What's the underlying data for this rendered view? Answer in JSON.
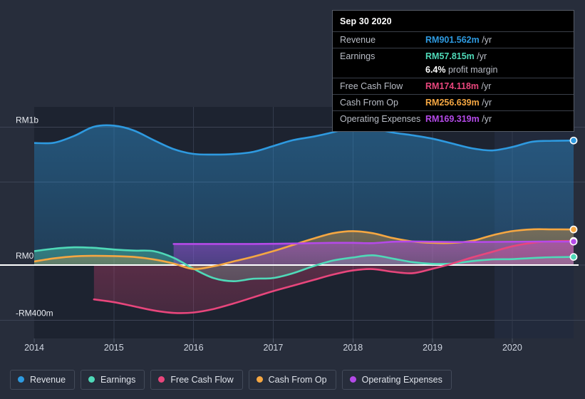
{
  "tooltip": {
    "date": "Sep 30 2020",
    "rows": [
      {
        "label": "Revenue",
        "value": "RM901.562m",
        "unit": "/yr",
        "color": "#2e9ae0"
      },
      {
        "label": "Earnings",
        "value": "RM57.815m",
        "unit": "/yr",
        "color": "#4fd9b8",
        "sub_value": "6.4%",
        "sub_unit": "profit margin"
      },
      {
        "label": "Free Cash Flow",
        "value": "RM174.118m",
        "unit": "/yr",
        "color": "#e8467c"
      },
      {
        "label": "Cash From Op",
        "value": "RM256.639m",
        "unit": "/yr",
        "color": "#f5a742"
      },
      {
        "label": "Operating Expenses",
        "value": "RM169.319m",
        "unit": "/yr",
        "color": "#b44ae8"
      }
    ]
  },
  "legend": {
    "items": [
      {
        "label": "Revenue",
        "color": "#2e9ae0"
      },
      {
        "label": "Earnings",
        "color": "#4fd9b8"
      },
      {
        "label": "Free Cash Flow",
        "color": "#e8467c"
      },
      {
        "label": "Cash From Op",
        "color": "#f5a742"
      },
      {
        "label": "Operating Expenses",
        "color": "#b44ae8"
      }
    ]
  },
  "chart_data": {
    "type": "area",
    "title": "",
    "xlabel": "",
    "ylabel": "",
    "currency": "RM",
    "grid": true,
    "legend_position": "bottom",
    "y_ticks": [
      {
        "label": "RM1b",
        "value": 1000
      },
      {
        "label": "RM0",
        "value": 0
      },
      {
        "label": "-RM400m",
        "value": -400
      }
    ],
    "ylim": [
      -533,
      1146
    ],
    "x_ticks": [
      "2014",
      "2015",
      "2016",
      "2017",
      "2018",
      "2019",
      "2020"
    ],
    "xlim": [
      2014,
      2020.77
    ],
    "forecast_start": 2019.77,
    "series": [
      {
        "name": "Revenue",
        "color": "#2e9ae0",
        "fill": "#2e9ae0",
        "x": [
          2014.0,
          2014.25,
          2014.5,
          2014.75,
          2015.0,
          2015.25,
          2015.5,
          2015.75,
          2016.0,
          2016.25,
          2016.5,
          2016.75,
          2017.0,
          2017.25,
          2017.5,
          2017.75,
          2018.0,
          2018.25,
          2018.5,
          2018.75,
          2019.0,
          2019.25,
          2019.5,
          2019.75,
          2020.0,
          2020.25,
          2020.5,
          2020.77
        ],
        "values": [
          884,
          886,
          935,
          1002,
          1010,
          975,
          905,
          840,
          805,
          800,
          804,
          820,
          862,
          905,
          930,
          962,
          1000,
          990,
          960,
          940,
          915,
          880,
          845,
          830,
          855,
          893,
          900,
          902
        ]
      },
      {
        "name": "Earnings",
        "color": "#4fd9b8",
        "fill": "#4fd9b8",
        "x": [
          2014.0,
          2014.25,
          2014.5,
          2014.75,
          2015.0,
          2015.25,
          2015.5,
          2015.75,
          2016.0,
          2016.25,
          2016.5,
          2016.75,
          2017.0,
          2017.25,
          2017.5,
          2017.75,
          2018.0,
          2018.25,
          2018.5,
          2018.75,
          2019.0,
          2019.25,
          2019.5,
          2019.75,
          2020.0,
          2020.25,
          2020.5,
          2020.77
        ],
        "values": [
          100,
          118,
          128,
          124,
          112,
          104,
          100,
          52,
          -28,
          -95,
          -118,
          -100,
          -95,
          -60,
          -10,
          32,
          54,
          70,
          46,
          20,
          8,
          10,
          28,
          40,
          42,
          50,
          56,
          58
        ]
      },
      {
        "name": "Free Cash Flow",
        "color": "#e8467c",
        "fill": "#e8467c",
        "x": [
          2014.75,
          2015.0,
          2015.25,
          2015.5,
          2015.75,
          2016.0,
          2016.25,
          2016.5,
          2016.75,
          2017.0,
          2017.25,
          2017.5,
          2017.75,
          2018.0,
          2018.25,
          2018.5,
          2018.75,
          2019.0,
          2019.25,
          2019.5,
          2019.75,
          2020.0,
          2020.25,
          2020.5,
          2020.77
        ],
        "values": [
          -250,
          -270,
          -300,
          -330,
          -348,
          -345,
          -320,
          -280,
          -235,
          -190,
          -150,
          -110,
          -70,
          -40,
          -30,
          -50,
          -60,
          -28,
          10,
          55,
          95,
          135,
          160,
          172,
          174
        ]
      },
      {
        "name": "Cash From Op",
        "color": "#f5a742",
        "fill": "#f5a742",
        "x": [
          2014.0,
          2014.25,
          2014.5,
          2014.75,
          2015.0,
          2015.25,
          2015.5,
          2015.75,
          2016.0,
          2016.25,
          2016.5,
          2016.75,
          2017.0,
          2017.25,
          2017.5,
          2017.75,
          2018.0,
          2018.25,
          2018.5,
          2018.75,
          2019.0,
          2019.25,
          2019.5,
          2019.75,
          2020.0,
          2020.25,
          2020.5,
          2020.77
        ],
        "values": [
          25,
          48,
          62,
          66,
          64,
          58,
          40,
          10,
          -30,
          -10,
          25,
          60,
          100,
          145,
          190,
          230,
          245,
          230,
          195,
          170,
          160,
          160,
          175,
          215,
          245,
          258,
          258,
          257
        ]
      },
      {
        "name": "Operating Expenses",
        "color": "#b44ae8",
        "fill": "#b44ae8",
        "x": [
          2015.75,
          2016.0,
          2016.25,
          2016.5,
          2016.75,
          2017.0,
          2017.25,
          2017.5,
          2017.75,
          2018.0,
          2018.25,
          2018.5,
          2018.75,
          2019.0,
          2019.25,
          2019.5,
          2019.75,
          2020.0,
          2020.25,
          2020.5,
          2020.77
        ],
        "values": [
          152,
          152,
          152,
          152,
          152,
          153,
          155,
          158,
          160,
          160,
          158,
          168,
          170,
          168,
          166,
          166,
          167,
          168,
          169,
          169,
          169
        ]
      }
    ]
  }
}
